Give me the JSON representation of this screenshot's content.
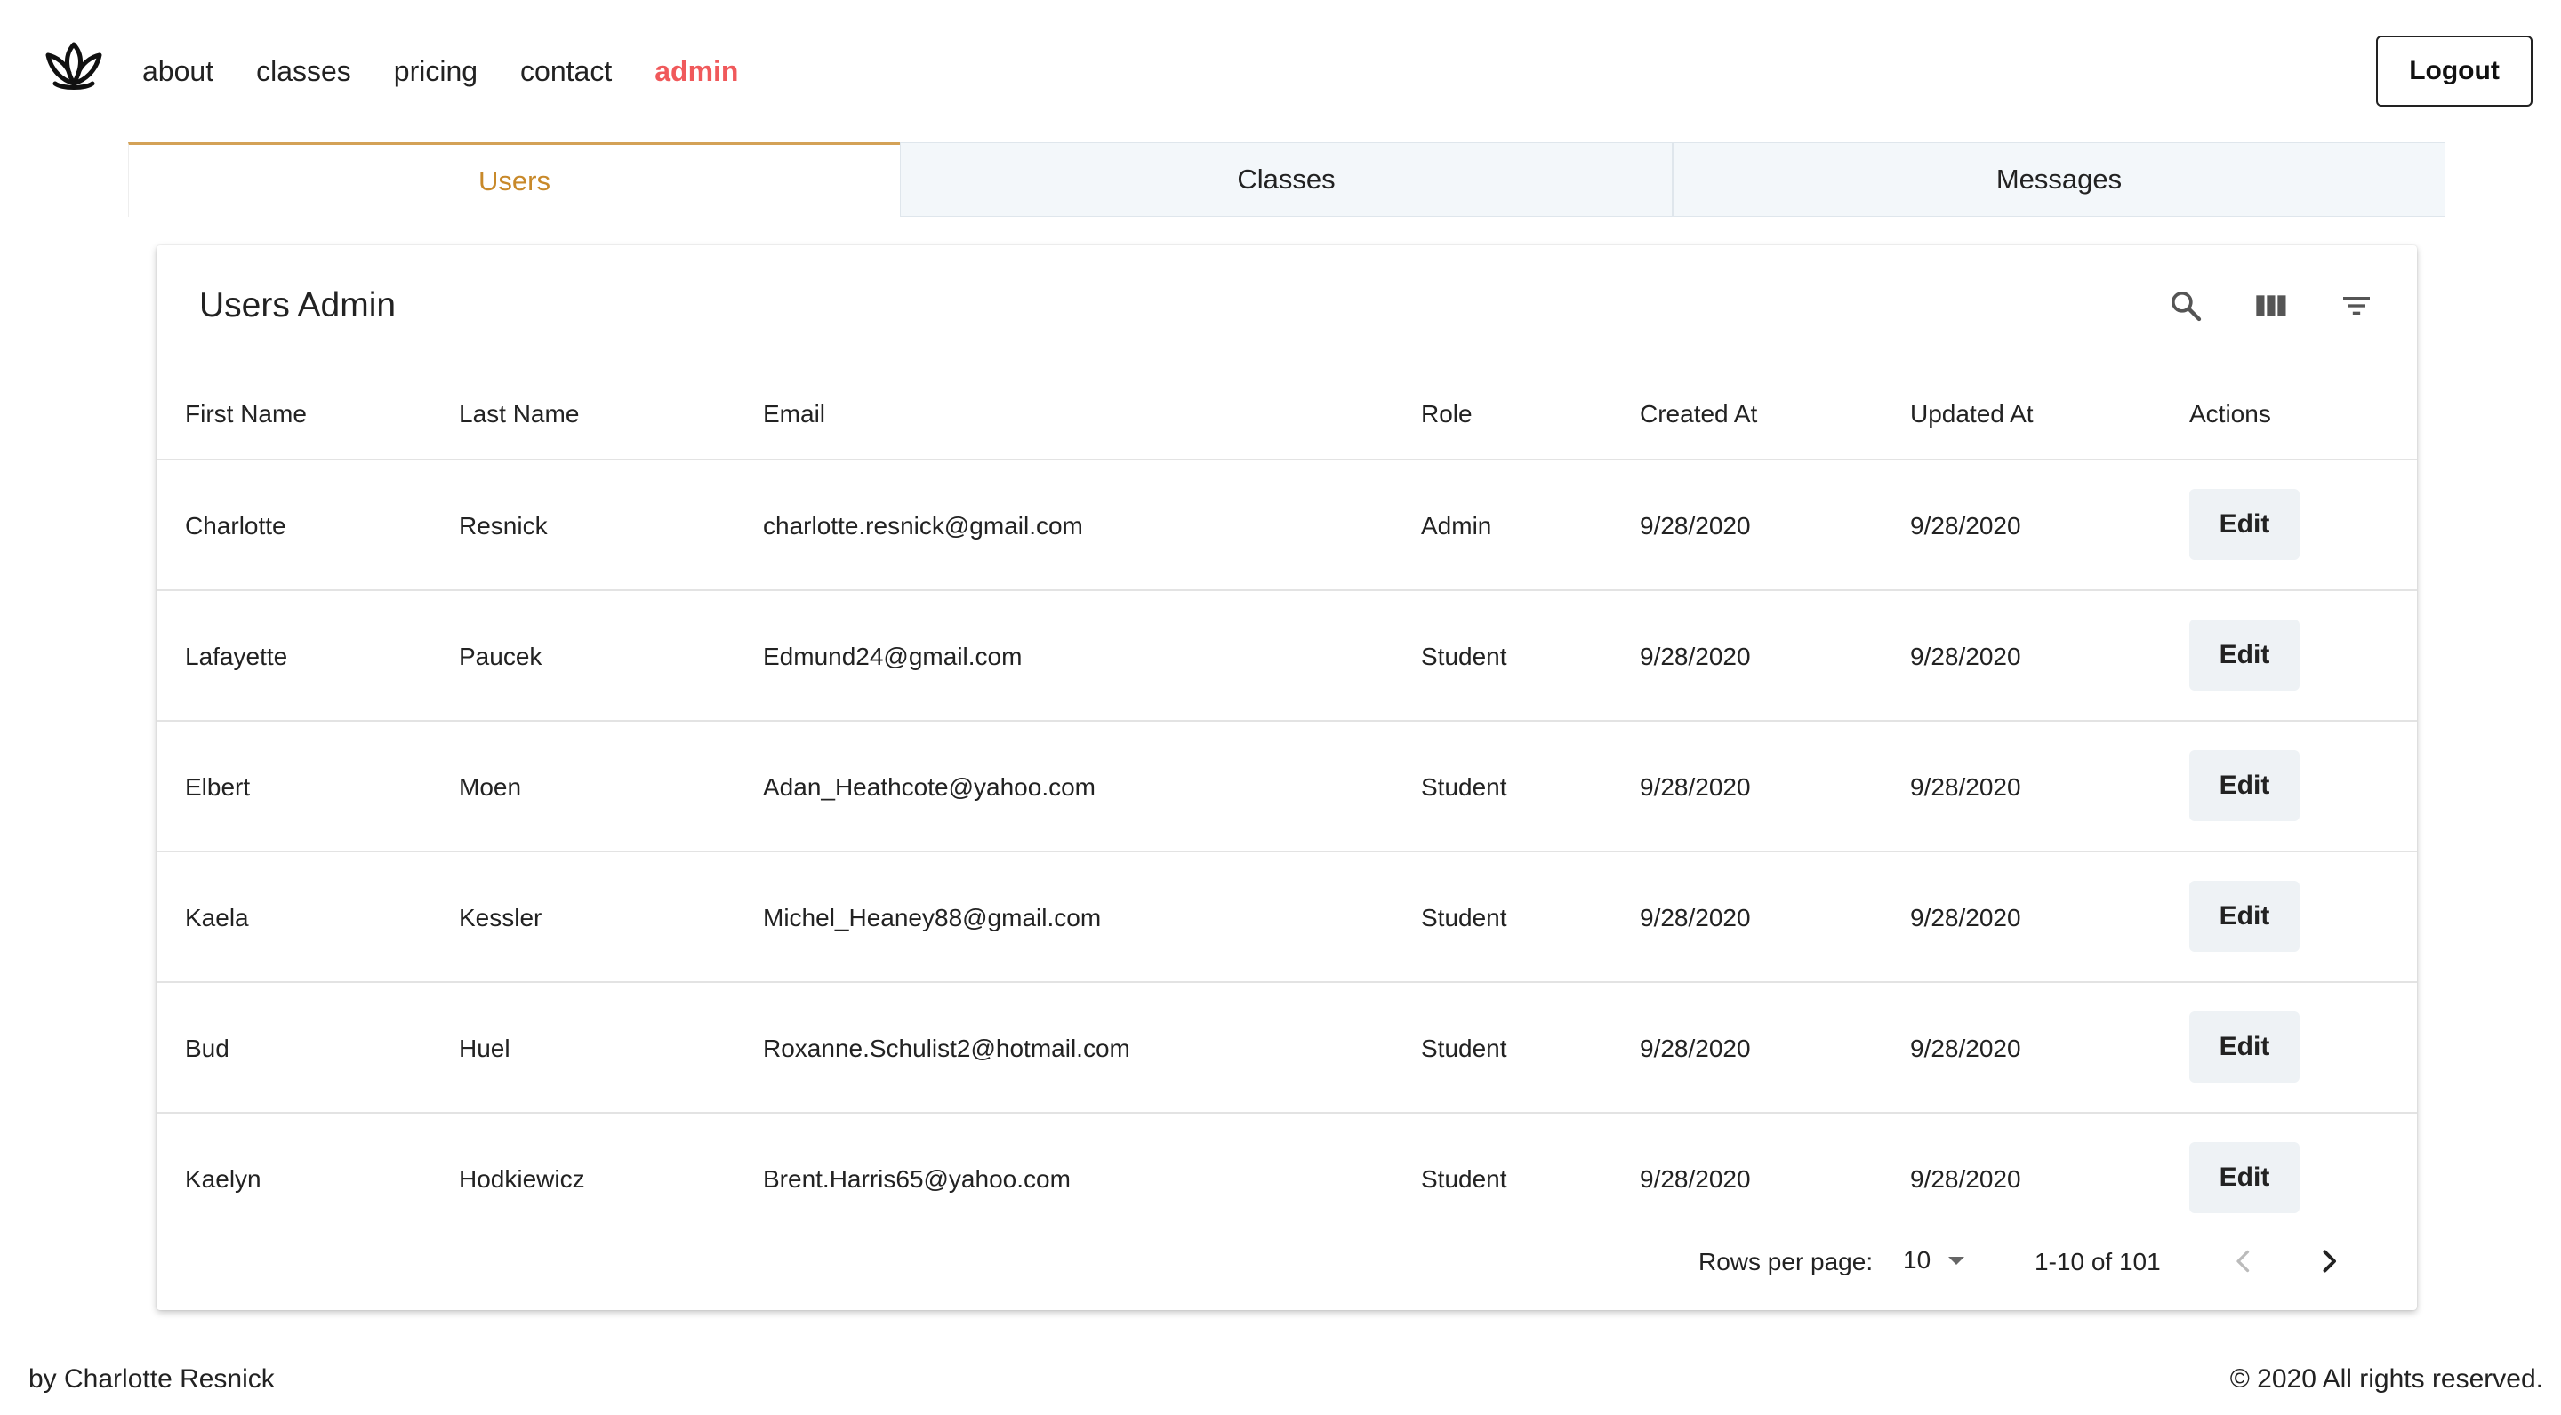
{
  "nav": {
    "logo_icon": "lotus-icon",
    "links": [
      {
        "label": "about",
        "active": false
      },
      {
        "label": "classes",
        "active": false
      },
      {
        "label": "pricing",
        "active": false
      },
      {
        "label": "contact",
        "active": false
      },
      {
        "label": "admin",
        "active": true
      }
    ],
    "logout_label": "Logout"
  },
  "tabs": [
    {
      "label": "Users",
      "active": true
    },
    {
      "label": "Classes",
      "active": false
    },
    {
      "label": "Messages",
      "active": false
    }
  ],
  "card": {
    "title": "Users Admin",
    "toolbar_icons": [
      "search-icon",
      "view-columns-icon",
      "filter-icon"
    ]
  },
  "table": {
    "headers": {
      "first_name": "First Name",
      "last_name": "Last Name",
      "email": "Email",
      "role": "Role",
      "created_at": "Created At",
      "updated_at": "Updated At",
      "actions": "Actions"
    },
    "rows": [
      {
        "first": "Charlotte",
        "last": "Resnick",
        "email": "charlotte.resnick@gmail.com",
        "role": "Admin",
        "created": "9/28/2020",
        "updated": "9/28/2020",
        "action": "Edit"
      },
      {
        "first": "Lafayette",
        "last": "Paucek",
        "email": "Edmund24@gmail.com",
        "role": "Student",
        "created": "9/28/2020",
        "updated": "9/28/2020",
        "action": "Edit"
      },
      {
        "first": "Elbert",
        "last": "Moen",
        "email": "Adan_Heathcote@yahoo.com",
        "role": "Student",
        "created": "9/28/2020",
        "updated": "9/28/2020",
        "action": "Edit"
      },
      {
        "first": "Kaela",
        "last": "Kessler",
        "email": "Michel_Heaney88@gmail.com",
        "role": "Student",
        "created": "9/28/2020",
        "updated": "9/28/2020",
        "action": "Edit"
      },
      {
        "first": "Bud",
        "last": "Huel",
        "email": "Roxanne.Schulist2@hotmail.com",
        "role": "Student",
        "created": "9/28/2020",
        "updated": "9/28/2020",
        "action": "Edit"
      },
      {
        "first": "Kaelyn",
        "last": "Hodkiewicz",
        "email": "Brent.Harris65@yahoo.com",
        "role": "Student",
        "created": "9/28/2020",
        "updated": "9/28/2020",
        "action": "Edit"
      }
    ]
  },
  "pagination": {
    "rows_per_page_label": "Rows per page:",
    "rows_per_page_value": "10",
    "range": "1-10 of 101",
    "prev_icon": "chevron-left-icon",
    "next_icon": "chevron-right-icon"
  },
  "footer": {
    "left": "by Charlotte Resnick",
    "right": "© 2020 All rights reserved."
  },
  "colors": {
    "accent_active_nav": "#f0595b",
    "active_tab_text": "#c8892a",
    "tab_background": "#f3f7fa",
    "edit_button_bg": "#eef2f5"
  }
}
